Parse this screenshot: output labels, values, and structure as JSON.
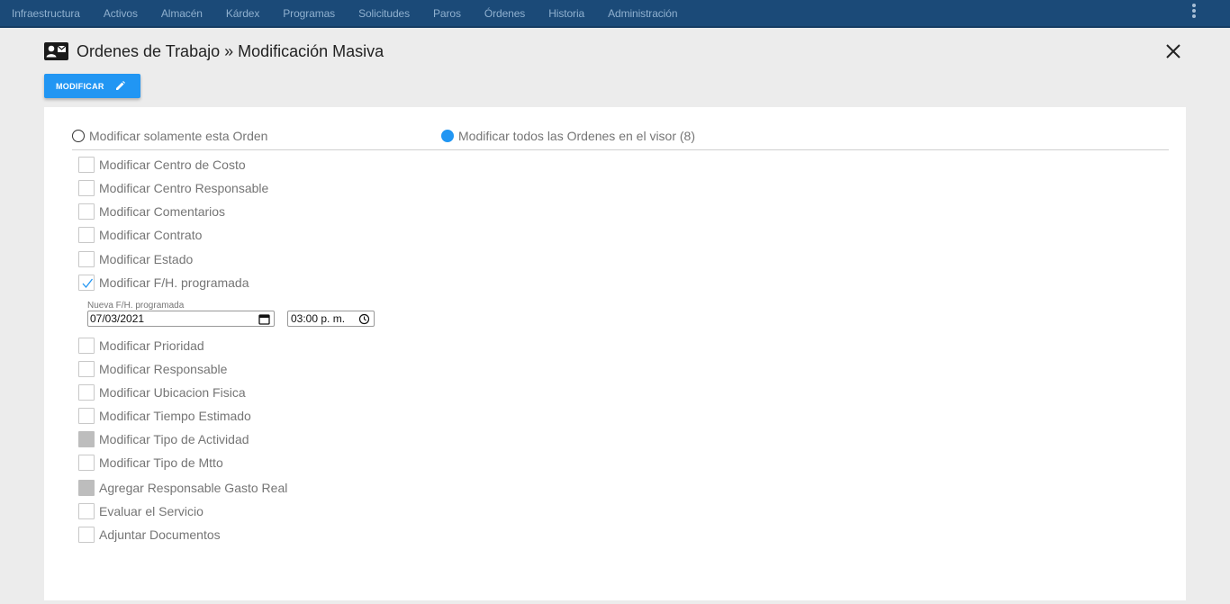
{
  "nav": {
    "items": [
      "Infraestructura",
      "Activos",
      "Almacén",
      "Kárdex",
      "Programas",
      "Solicitudes",
      "Paros",
      "Órdenes",
      "Historia",
      "Administración"
    ]
  },
  "header": {
    "title": "Ordenes de Trabajo » Modificación Masiva",
    "icon": "contact-card-icon"
  },
  "toolbar": {
    "modify_label": "MODIFICAR"
  },
  "radios": [
    {
      "label": "Modificar solamente esta Orden",
      "selected": false
    },
    {
      "label": "Modificar todos las Ordenes en el visor (8)",
      "selected": true
    }
  ],
  "options": [
    {
      "label": "Modificar Centro de Costo",
      "state": "unchecked"
    },
    {
      "label": "Modificar Centro Responsable",
      "state": "unchecked"
    },
    {
      "label": "Modificar Comentarios",
      "state": "unchecked"
    },
    {
      "label": "Modificar Contrato",
      "state": "unchecked"
    },
    {
      "label": "Modificar Estado",
      "state": "unchecked"
    },
    {
      "label": "Modificar F/H. programada",
      "state": "checked"
    },
    {
      "label": "Modificar Prioridad",
      "state": "unchecked"
    },
    {
      "label": "Modificar Responsable",
      "state": "unchecked"
    },
    {
      "label": "Modificar Ubicacion Fisica",
      "state": "unchecked"
    },
    {
      "label": "Modificar Tiempo Estimado",
      "state": "unchecked"
    },
    {
      "label": "Modificar Tipo de Actividad",
      "state": "disabled"
    },
    {
      "label": "Modificar Tipo de Mtto",
      "state": "unchecked"
    },
    {
      "label": "Agregar Responsable Gasto Real",
      "state": "disabled"
    },
    {
      "label": "Evaluar el Servicio",
      "state": "unchecked"
    },
    {
      "label": "Adjuntar Documentos",
      "state": "unchecked"
    }
  ],
  "schedule": {
    "label": "Nueva F/H. programada",
    "date": "07/03/2021",
    "time": "03:00 p. m."
  },
  "colors": {
    "nav_bg": "#1b4a78",
    "accent": "#2196f3",
    "page_bg": "#ececec"
  }
}
